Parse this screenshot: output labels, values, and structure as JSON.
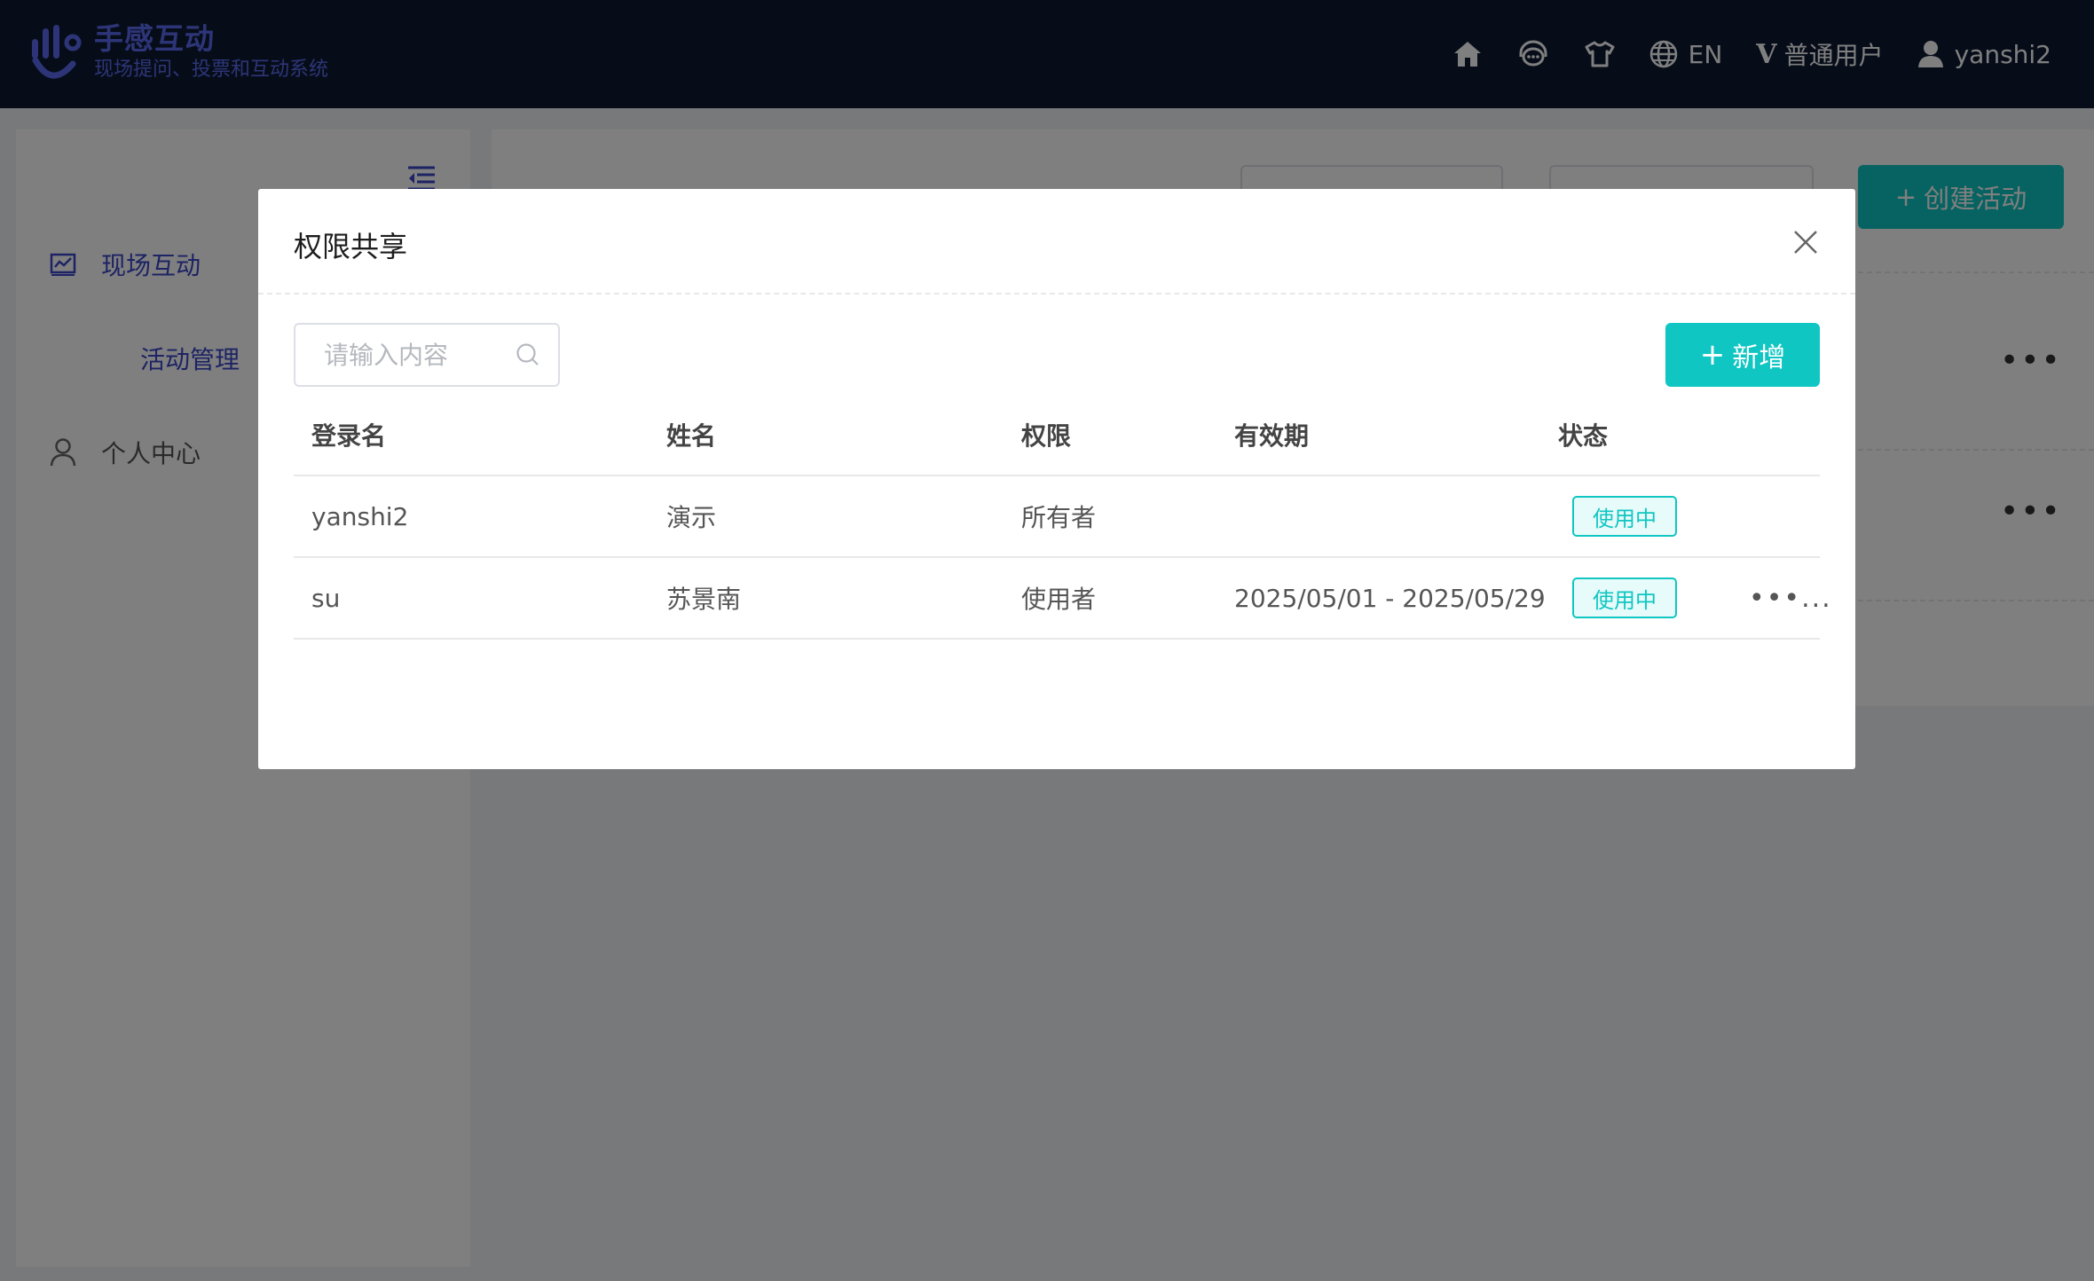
{
  "header": {
    "logo_title": "手感互动",
    "logo_subtitle": "现场提问、投票和互动系统",
    "language_label": "EN",
    "plan_label": "普通用户",
    "plan_prefix": "V",
    "username": "yanshi2"
  },
  "sidebar": {
    "items": [
      {
        "label": "现场互动",
        "icon": "chart-icon"
      },
      {
        "label": "活动管理"
      },
      {
        "label": "个人中心",
        "icon": "person-icon"
      }
    ]
  },
  "background": {
    "create_label": "创建活动",
    "create_prefix": "+"
  },
  "modal": {
    "title": "权限共享",
    "search_placeholder": "请输入内容",
    "add_label": "新增",
    "add_prefix": "+",
    "columns": [
      "登录名",
      "姓名",
      "权限",
      "有效期",
      "状态"
    ],
    "rows": [
      {
        "login": "yanshi2",
        "name": "演示",
        "permission": "所有者",
        "validity": "",
        "status": "使用中",
        "more": ""
      },
      {
        "login": "su",
        "name": "苏景南",
        "permission": "使用者",
        "validity": "2025/05/01 - 2025/05/29",
        "status": "使用中",
        "more": "•••..."
      }
    ]
  },
  "colors": {
    "topbar": "#0d1b33",
    "brand": "#5b6bf0",
    "accent": "#0fc6c2",
    "active_menu": "#3a47c8"
  }
}
